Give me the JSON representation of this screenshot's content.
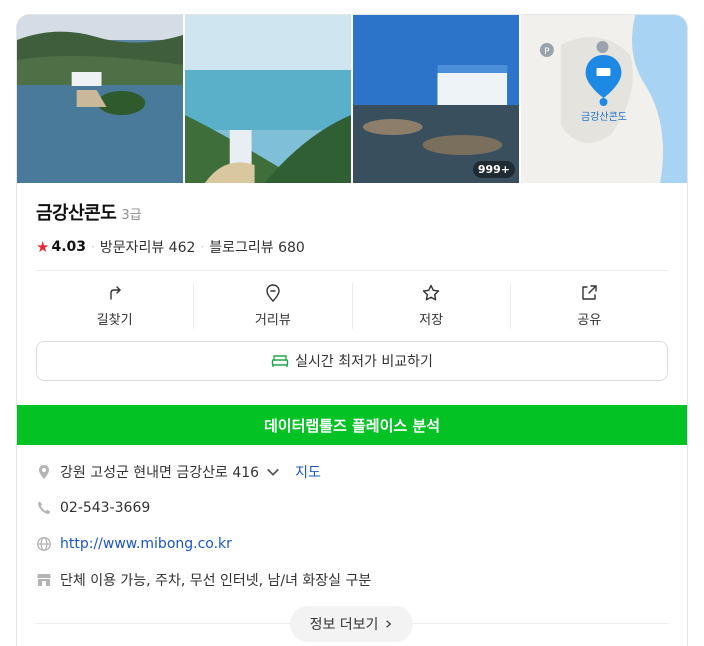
{
  "place": {
    "name": "금강산콘도",
    "grade": "3급",
    "rating": "4.03",
    "visitor_reviews": "방문자리뷰 462",
    "blog_reviews": "블로그리뷰 680"
  },
  "photos": {
    "count_badge": "999+",
    "map_label": "금강산콘도"
  },
  "actions": [
    {
      "label": "길찾기",
      "icon": "directions-icon"
    },
    {
      "label": "거리뷰",
      "icon": "street-view-icon"
    },
    {
      "label": "저장",
      "icon": "star-icon"
    },
    {
      "label": "공유",
      "icon": "share-icon"
    }
  ],
  "compare_button": "실시간 최저가 비교하기",
  "banner": "데이터랩툴즈 플레이스 분석",
  "info": {
    "address": "강원 고성군 현내면 금강산로 416",
    "map_link": "지도",
    "phone": "02-543-3669",
    "website": "http://www.mibong.co.kr",
    "amenities": "단체 이용 가능, 주차, 무선 인터넷, 남/녀 화장실 구분"
  },
  "more_button": "정보 더보기",
  "colors": {
    "rating_star": "#e8283a",
    "banner_green": "#03c223",
    "link_blue": "#1b56c5",
    "map_pin": "#1e88e5"
  }
}
